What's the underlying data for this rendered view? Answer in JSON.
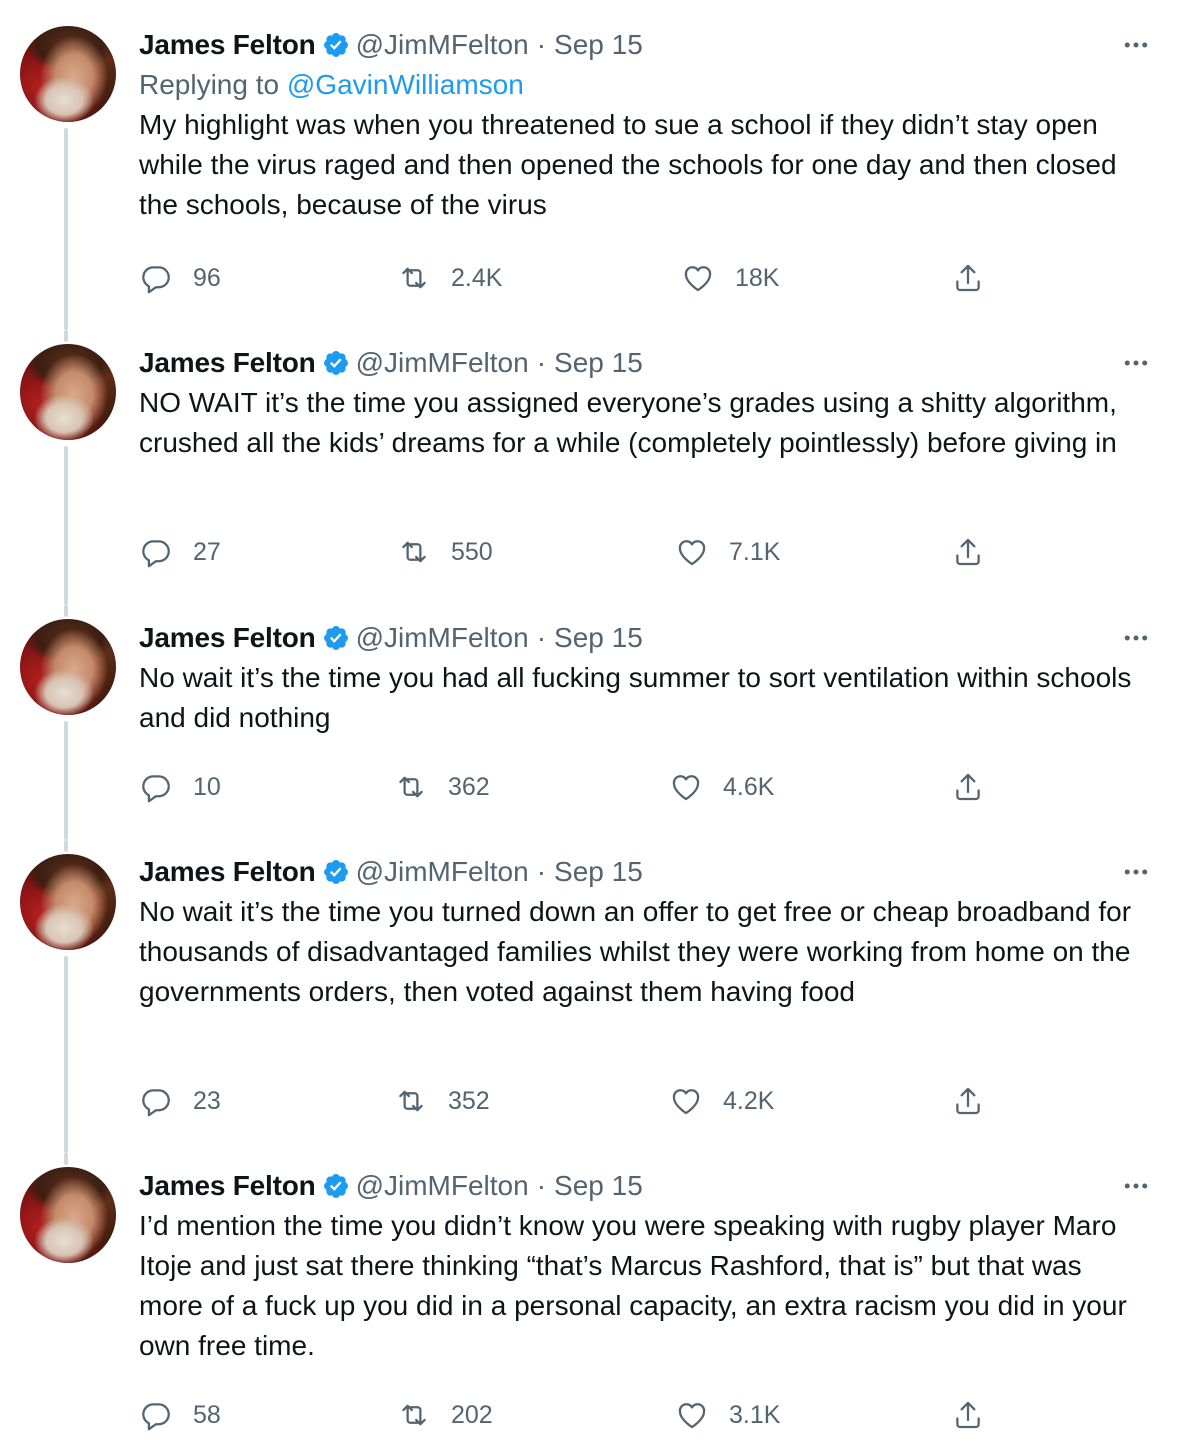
{
  "colors": {
    "text": "#0f1419",
    "secondary": "#536471",
    "link": "#1d9bf0",
    "verified": "#1d9bf0",
    "thread_line": "#cfd9de"
  },
  "icons": {
    "verified": "verified-badge-icon",
    "more": "more-options-icon",
    "reply": "reply-icon",
    "retweet": "retweet-icon",
    "like": "heart-icon",
    "share": "share-icon"
  },
  "tweets": [
    {
      "name": "James Felton",
      "handle": "@JimMFelton",
      "separator": "·",
      "date": "Sep 15",
      "replying_prefix": "Replying to",
      "replying_to": "@GavinWilliamson",
      "text": "My highlight was when you threatened to sue a school if they didn’t stay open while the virus raged and then opened the schools for one day and then closed the schools, because of the virus",
      "replies": "96",
      "retweets": "2.4K",
      "likes": "18K"
    },
    {
      "name": "James Felton",
      "handle": "@JimMFelton",
      "separator": "·",
      "date": "Sep 15",
      "text": "NO WAIT it’s the time you assigned everyone’s grades using a shitty algorithm, crushed all the kids’ dreams for a while (completely pointlessly) before giving in",
      "replies": "27",
      "retweets": "550",
      "likes": "7.1K"
    },
    {
      "name": "James Felton",
      "handle": "@JimMFelton",
      "separator": "·",
      "date": "Sep 15",
      "text": "No wait it’s the time you had all fucking summer to sort ventilation within schools and did nothing",
      "replies": "10",
      "retweets": "362",
      "likes": "4.6K"
    },
    {
      "name": "James Felton",
      "handle": "@JimMFelton",
      "separator": "·",
      "date": "Sep 15",
      "text": "No wait it’s the time you turned down an offer to get free or cheap broadband for thousands of disadvantaged families whilst they were working from home on the governments orders, then voted against them having food",
      "replies": "23",
      "retweets": "352",
      "likes": "4.2K"
    },
    {
      "name": "James Felton",
      "handle": "@JimMFelton",
      "separator": "·",
      "date": "Sep 15",
      "text": "I’d mention the time you didn’t know you were speaking with rugby player Maro Itoje and just sat there thinking “that’s Marcus Rashford, that is” but that was more of a fuck up you did in a personal capacity, an extra racism you did in your own free time.",
      "replies": "58",
      "retweets": "202",
      "likes": "3.1K"
    }
  ]
}
